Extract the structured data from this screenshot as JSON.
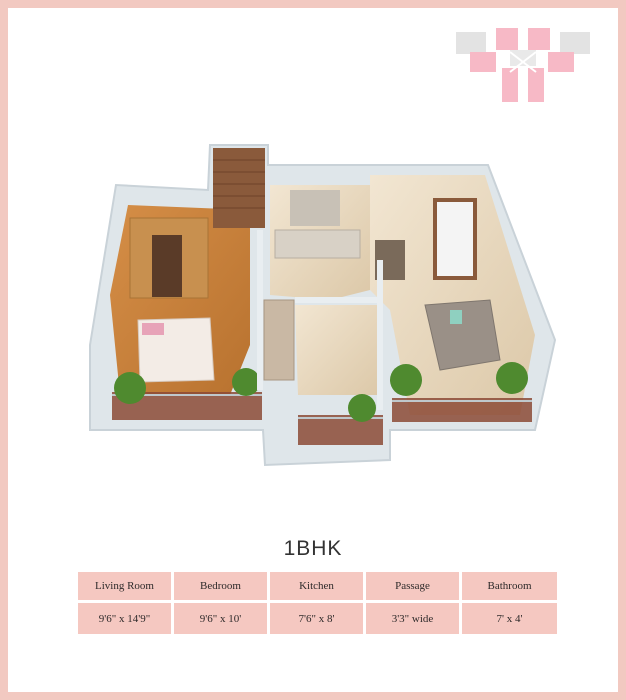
{
  "title": "1BHK",
  "table": {
    "headers": [
      "Living Room",
      "Bedroom",
      "Kitchen",
      "Passage",
      "Bathroom"
    ],
    "values": [
      "9'6\" x 14'9\"",
      "9'6\" x 10'",
      "7'6\" x 8'",
      "3'3\" wide",
      "7' x 4'"
    ]
  },
  "colors": {
    "border": "#f2c9c1",
    "cell": "#f5c8c1",
    "floor_wood": "#c9833f",
    "wall": "#dfe6ea"
  }
}
